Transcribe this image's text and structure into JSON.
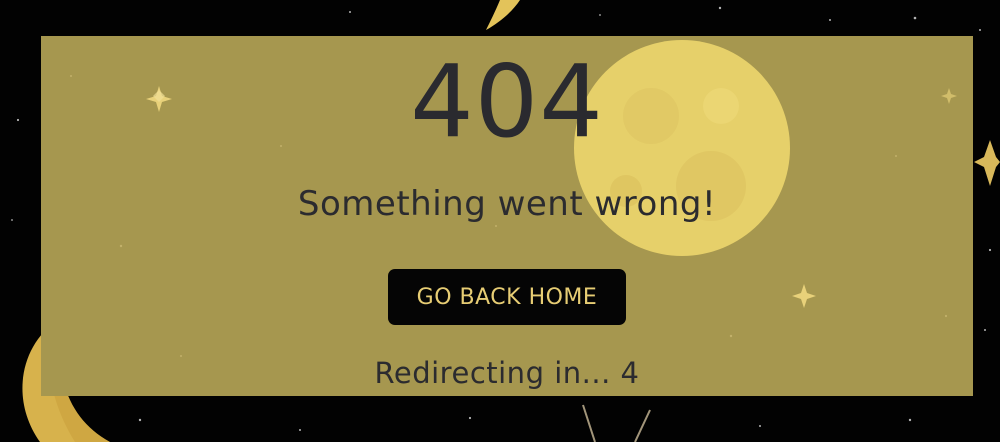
{
  "error": {
    "code": "404",
    "message": "Something went wrong!",
    "button_label": "GO BACK HOME",
    "redirect_text": "Redirecting in... 4"
  },
  "colors": {
    "background": "#000000",
    "panel": "#a6974f",
    "text": "#2a2a2f",
    "button_bg": "#050505",
    "button_text": "#e7cd74",
    "moon": "#e6d06a"
  },
  "decorations": {
    "moon_icon": "full-moon",
    "star_icon": "sparkle-star",
    "crescent_icon": "crescent-moon"
  }
}
